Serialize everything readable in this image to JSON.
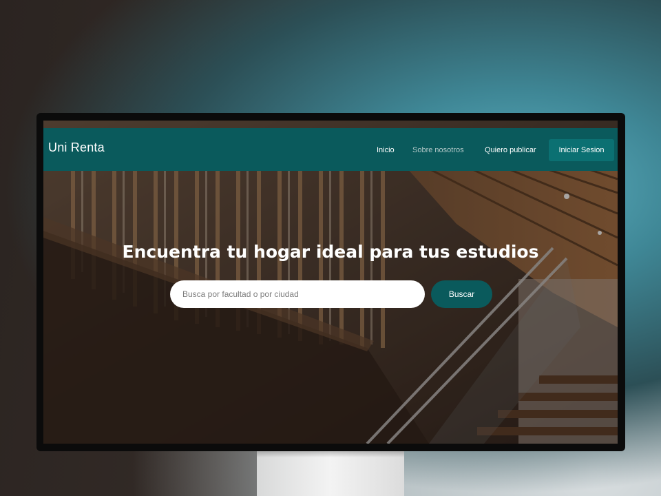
{
  "navbar": {
    "brand": "Uni Renta",
    "links": [
      {
        "label": "Inicio"
      },
      {
        "label": "Sobre nosotros"
      },
      {
        "label": "Quiero publicar"
      }
    ],
    "login_label": "Iniciar Sesion"
  },
  "hero": {
    "title": "Encuentra tu hogar ideal para tus estudios",
    "search": {
      "placeholder": "Busca por facultad o por ciudad",
      "value": "",
      "button_label": "Buscar"
    },
    "background_image": "staircase-photo"
  },
  "colors": {
    "primary": "#0a5a5c",
    "button": "#0b7072",
    "text_on_primary": "#ffffff"
  }
}
